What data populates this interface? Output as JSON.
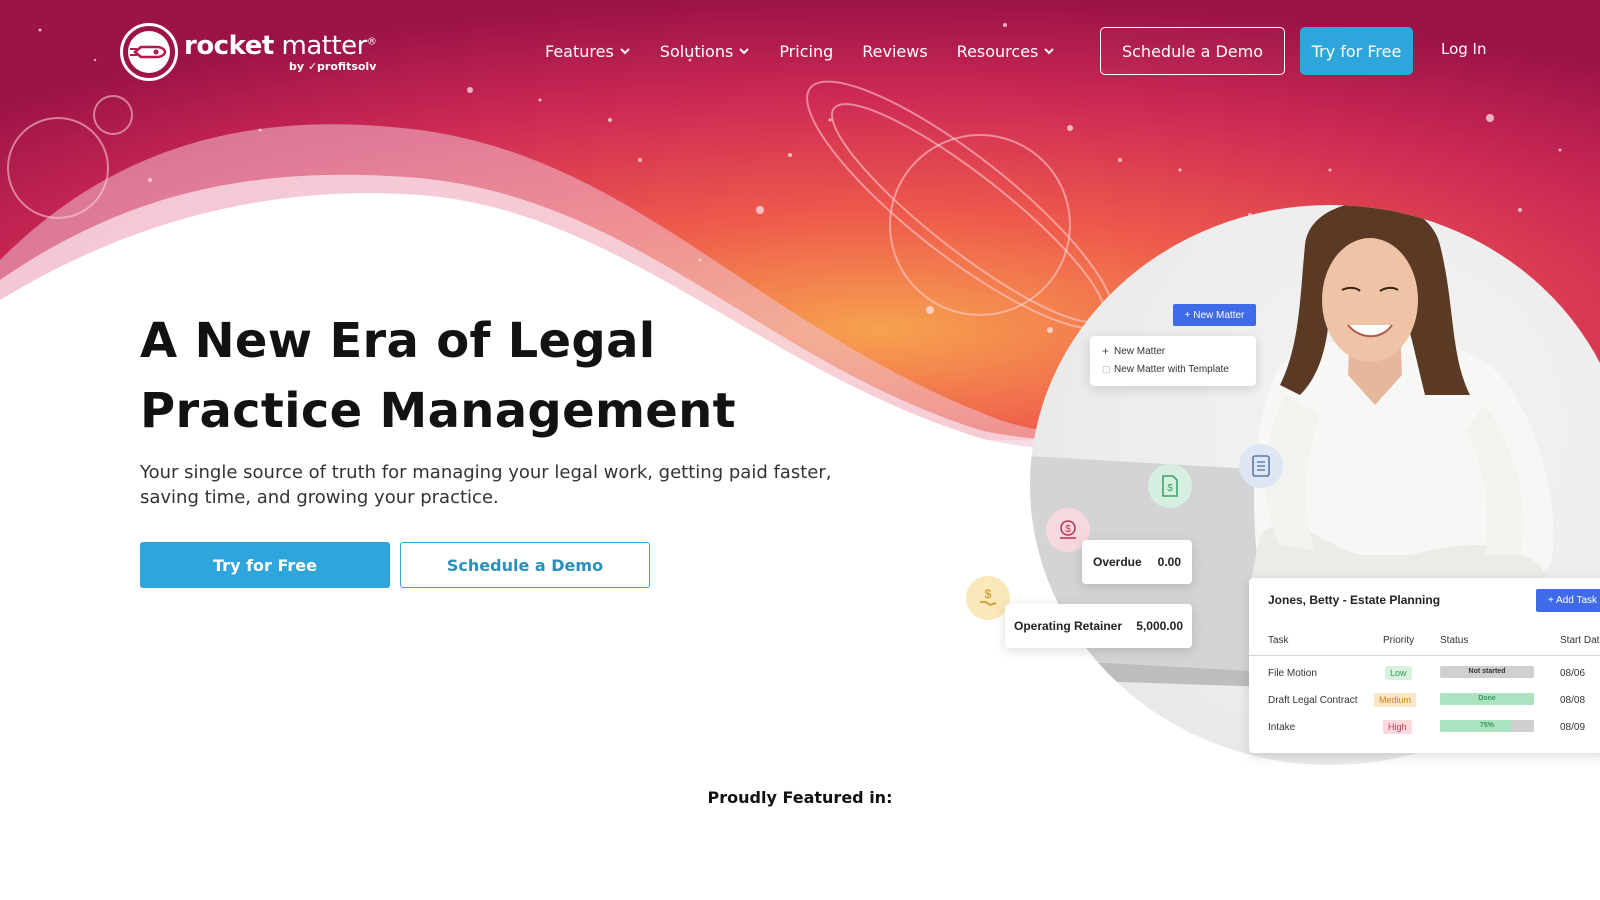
{
  "brand": {
    "name_bold": "rocket",
    "name_light": " matter",
    "registered": "®",
    "byline": "by ✓profitsolv"
  },
  "nav": {
    "items": [
      {
        "label": "Features",
        "has_dropdown": true
      },
      {
        "label": "Solutions",
        "has_dropdown": true
      },
      {
        "label": "Pricing",
        "has_dropdown": false
      },
      {
        "label": "Reviews",
        "has_dropdown": false
      },
      {
        "label": "Resources",
        "has_dropdown": true
      }
    ],
    "schedule_demo": "Schedule a Demo",
    "try_free": "Try for Free",
    "login": "Log In"
  },
  "hero": {
    "title_line1": "A New Era of Legal",
    "title_line2": "Practice Management",
    "subtitle": "Your single source of truth for managing your legal work, getting paid faster, saving time, and growing your practice.",
    "cta_primary": "Try for Free",
    "cta_secondary": "Schedule a Demo"
  },
  "illustration": {
    "new_matter_button": "+ New Matter",
    "menu": {
      "item1": "New Matter",
      "item2": "New Matter with Template"
    },
    "overdue": {
      "label": "Overdue",
      "value": "0.00"
    },
    "retainer": {
      "label": "Operating Retainer",
      "value": "5,000.00"
    },
    "task_card": {
      "title": "Jones, Betty - Estate Planning",
      "add_task": "+ Add Task",
      "columns": {
        "task": "Task",
        "priority": "Priority",
        "status": "Status",
        "start_date": "Start Date"
      },
      "rows": [
        {
          "task": "File Motion",
          "priority": "Low",
          "status": "Not started",
          "progress": 0,
          "date": "08/06"
        },
        {
          "task": "Draft Legal Contract",
          "priority": "Medium",
          "status": "Done",
          "progress": 100,
          "date": "08/08"
        },
        {
          "task": "Intake",
          "priority": "High",
          "status": "75%",
          "progress": 75,
          "date": "08/09"
        }
      ]
    }
  },
  "featured": {
    "label": "Proudly Featured in:"
  },
  "colors": {
    "accent": "#2ea6db",
    "hero_magenta": "#b8184f",
    "hero_orange": "#f27a4a",
    "task_blue": "#3f6ae8"
  }
}
